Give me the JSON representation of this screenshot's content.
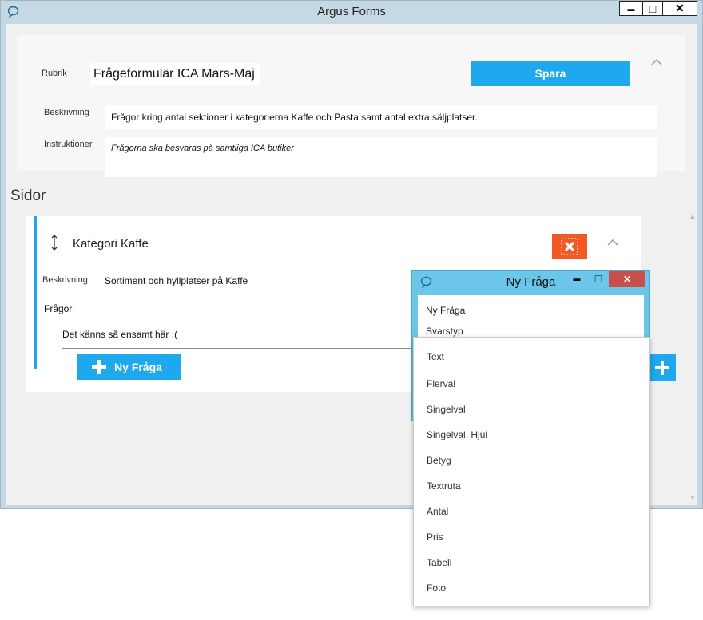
{
  "window": {
    "title": "Argus Forms",
    "buttons": {
      "minimize": "▬",
      "maximize": "□",
      "close": "✕"
    }
  },
  "header": {
    "rubrik_label": "Rubrik",
    "rubrik_value": "Frågeformulär ICA Mars-Maj",
    "save_label": "Spara",
    "beskrivning_label": "Beskrivning",
    "beskrivning_value": "Frågor kring antal sektioner i kategorierna Kaffe och Pasta samt antal extra säljplatser.",
    "instruktioner_label": "Instruktioner",
    "instruktioner_value": "Frågorna ska besvaras på samtliga ICA butiker"
  },
  "sidor_label": "Sidor",
  "page": {
    "title": "Kategori Kaffe",
    "beskrivning_label": "Beskrivning",
    "beskrivning_value": "Sortiment och hyllplatser på Kaffe",
    "fragor_label": "Frågor",
    "empty_text": "Det känns så ensamt här :(",
    "new_question_label": "Ny Fråga"
  },
  "dialog": {
    "title": "Ny Fråga",
    "field_name": "Ny Fråga",
    "field_type_label": "Svarstyp"
  },
  "dropdown": {
    "options": [
      "Text",
      "Flerval",
      "Singelval",
      "Singelval, Hjul",
      "Betyg",
      "Textruta",
      "Antal",
      "Pris",
      "Tabell",
      "Foto"
    ]
  },
  "colors": {
    "accent": "#1ea8ee",
    "danger": "#f15a24",
    "dialog": "#6bc6e9",
    "window_bg": "#c5d9e5"
  }
}
